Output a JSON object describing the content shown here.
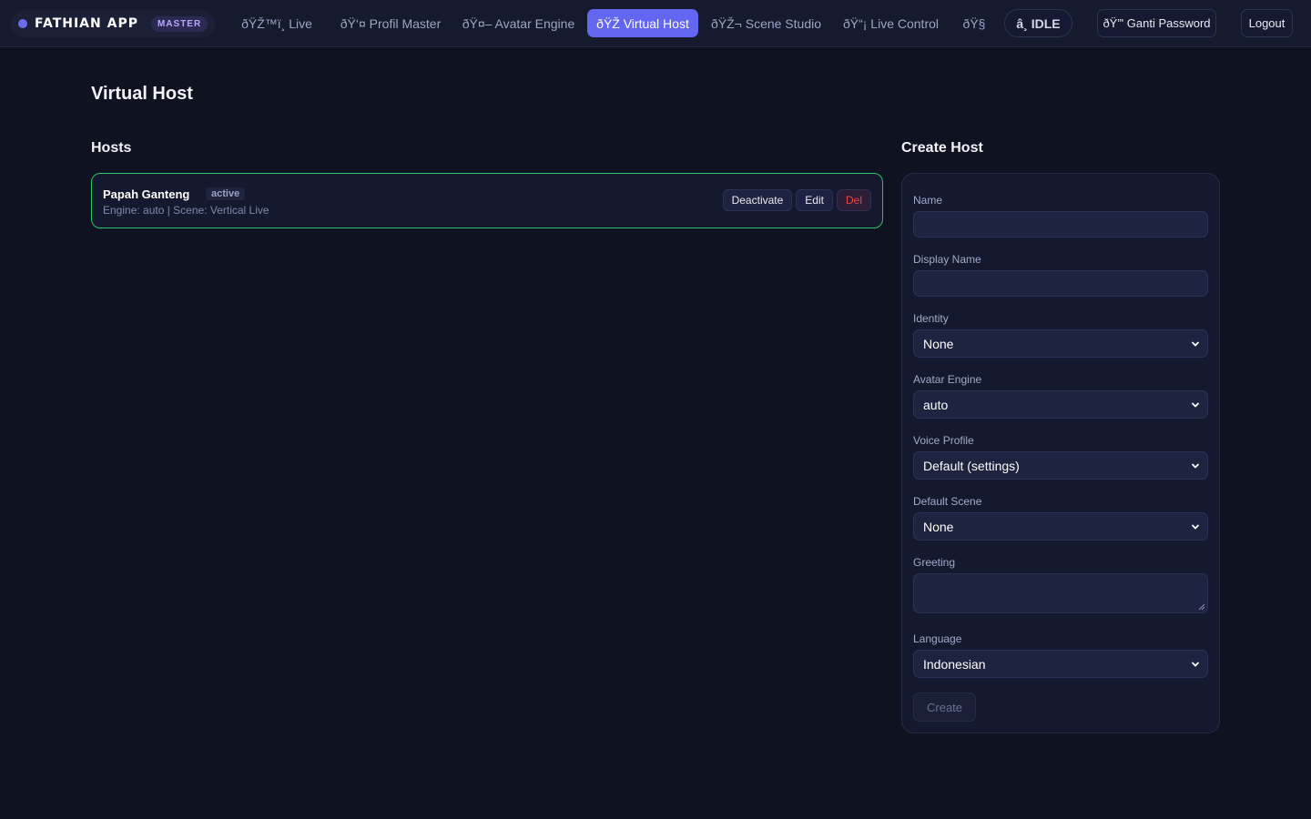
{
  "app": {
    "name": "FATHIAN APP",
    "badge": "MASTER"
  },
  "nav": {
    "items": [
      {
        "label": "ðŸŽ™ï¸ Live",
        "active": false
      },
      {
        "label": "ðŸ‘¤ Profil Master",
        "active": false
      },
      {
        "label": "ðŸ¤– Avatar Engine",
        "active": false
      },
      {
        "label": "ðŸŽ Virtual Host",
        "active": true
      },
      {
        "label": "ðŸŽ¬ Scene Studio",
        "active": false
      },
      {
        "label": "ðŸ“¡ Live Control",
        "active": false
      },
      {
        "label": "ðŸ§",
        "active": false
      }
    ],
    "status_pill": "â¸ IDLE",
    "change_password": "ðŸ”' Ganti Password",
    "logout": "Logout"
  },
  "page": {
    "title": "Virtual Host"
  },
  "hosts": {
    "title": "Hosts",
    "items": [
      {
        "name": "Papah Ganteng",
        "status": "active",
        "meta": "Engine: auto | Scene: Vertical Live",
        "actions": {
          "deactivate": "Deactivate",
          "edit": "Edit",
          "delete": "Del"
        }
      }
    ]
  },
  "create_host": {
    "title": "Create Host",
    "fields": {
      "name": {
        "label": "Name",
        "value": ""
      },
      "display_name": {
        "label": "Display Name",
        "value": ""
      },
      "identity": {
        "label": "Identity",
        "value": "None"
      },
      "avatar_engine": {
        "label": "Avatar Engine",
        "value": "auto"
      },
      "voice_profile": {
        "label": "Voice Profile",
        "value": "Default (settings)"
      },
      "default_scene": {
        "label": "Default Scene",
        "value": "None"
      },
      "greeting": {
        "label": "Greeting",
        "value": ""
      },
      "language": {
        "label": "Language",
        "value": "Indonesian"
      }
    },
    "submit": "Create"
  },
  "colors": {
    "background": "#0f1221",
    "accent": "#6366f1",
    "active_border": "#22c55e",
    "danger": "#ef4444"
  }
}
